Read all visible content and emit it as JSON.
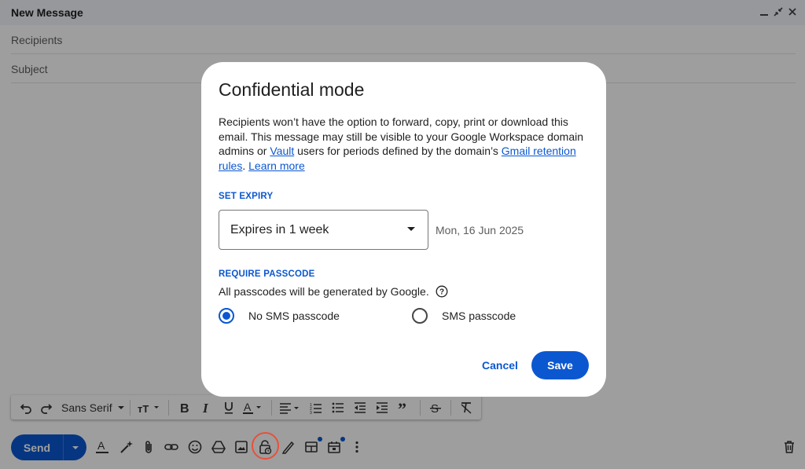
{
  "compose": {
    "title": "New Message",
    "recipients_placeholder": "Recipients",
    "subject_placeholder": "Subject"
  },
  "toolbar": {
    "font": "Sans Serif",
    "icons": [
      "undo-icon",
      "redo-icon",
      "font-size-icon",
      "bold-icon",
      "italic-icon",
      "underline-icon",
      "text-color-icon",
      "align-icon",
      "numbered-list-icon",
      "bulleted-list-icon",
      "indent-less-icon",
      "indent-more-icon",
      "quote-icon",
      "strikethrough-icon",
      "remove-formatting-icon"
    ]
  },
  "bottom_bar": {
    "send_label": "Send",
    "icons": [
      "formatting-options-icon",
      "ai-write-icon",
      "attach-icon",
      "link-icon",
      "emoji-icon",
      "drive-icon",
      "photo-icon",
      "confidential-mode-icon",
      "signature-icon",
      "layouts-icon",
      "schedule-icon",
      "more-options-icon",
      "discard-icon"
    ]
  },
  "dialog": {
    "title": "Confidential mode",
    "body_text_1": "Recipients won’t have the option to forward, copy, print or download this email. This message may still be visible to your Google Workspace domain admins or ",
    "vault_link": "Vault",
    "body_text_2": " users for periods defined by the domain’s ",
    "retention_link": "Gmail retention rules",
    "body_text_3": ". ",
    "learn_more_link": "Learn more",
    "expiry_label": "SET EXPIRY",
    "expiry_value": "Expires in 1 week",
    "expiry_date": "Mon, 16 Jun 2025",
    "passcode_label": "REQUIRE PASSCODE",
    "passcode_info": "All passcodes will be generated by Google.",
    "radio_no_sms": "No SMS passcode",
    "radio_sms": "SMS passcode",
    "selected_option": "No SMS passcode",
    "cancel_label": "Cancel",
    "save_label": "Save"
  },
  "colors": {
    "accent": "#0b57d0",
    "highlight_ring": "#e8503a",
    "scrim": "rgba(0,0,0,0.38)"
  }
}
